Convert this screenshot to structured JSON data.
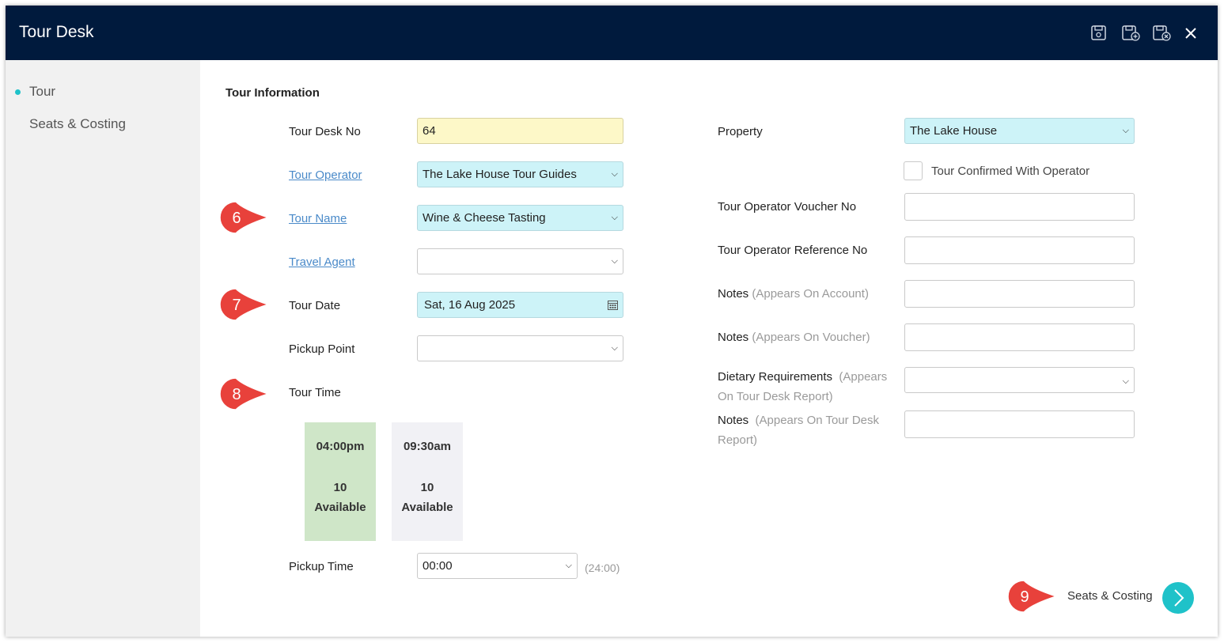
{
  "window": {
    "title": "Tour Desk"
  },
  "toolbar": {
    "icons": [
      "save-icon",
      "save-new-icon",
      "save-close-icon",
      "close-icon"
    ]
  },
  "sidebar": {
    "items": [
      {
        "label": "Tour",
        "active": true
      },
      {
        "label": "Seats & Costing",
        "active": false
      }
    ]
  },
  "section": {
    "title": "Tour Information"
  },
  "form": {
    "tour_desk_no": {
      "label": "Tour Desk No",
      "value": "64"
    },
    "tour_operator": {
      "label": "Tour Operator",
      "value": "The Lake House Tour Guides"
    },
    "tour_name": {
      "label": "Tour Name",
      "value": "Wine & Cheese Tasting"
    },
    "travel_agent": {
      "label": "Travel Agent",
      "value": ""
    },
    "tour_date": {
      "label": "Tour Date",
      "value": "Sat, 16 Aug 2025"
    },
    "pickup_point": {
      "label": "Pickup Point",
      "value": ""
    },
    "tour_time": {
      "label": "Tour Time"
    },
    "time_slots": [
      {
        "time": "04:00pm",
        "count": "10",
        "status": "Available",
        "selected": true
      },
      {
        "time": "09:30am",
        "count": "10",
        "status": "Available",
        "selected": false
      }
    ],
    "pickup_time": {
      "label": "Pickup Time",
      "value": "00:00",
      "hint": "(24:00)"
    },
    "property": {
      "label": "Property",
      "value": "The Lake House"
    },
    "tour_confirmed": {
      "label": "Tour Confirmed With Operator",
      "checked": false
    },
    "voucher_no": {
      "label": "Tour Operator Voucher No",
      "value": ""
    },
    "reference_no": {
      "label": "Tour Operator Reference No",
      "value": ""
    },
    "notes_account": {
      "label": "Notes",
      "hint": "(Appears On Account)",
      "value": ""
    },
    "notes_voucher": {
      "label": "Notes",
      "hint": "(Appears On Voucher)",
      "value": ""
    },
    "dietary": {
      "label": "Dietary Requirements",
      "hint": "(Appears On Tour Desk Report)",
      "value": ""
    },
    "notes_report": {
      "label": "Notes",
      "hint": "(Appears On Tour Desk Report)",
      "value": ""
    }
  },
  "footer": {
    "next_label": "Seats & Costing"
  },
  "annotations": [
    "6",
    "7",
    "8",
    "9"
  ],
  "colors": {
    "header": "#001a3d",
    "accent": "#1fc2c9",
    "field_cyan": "#cdf3f8",
    "field_yellow": "#fdf8c8",
    "slot_selected": "#cfe6c8",
    "slot_default": "#f1f1f5",
    "badge": "#e8413b"
  }
}
